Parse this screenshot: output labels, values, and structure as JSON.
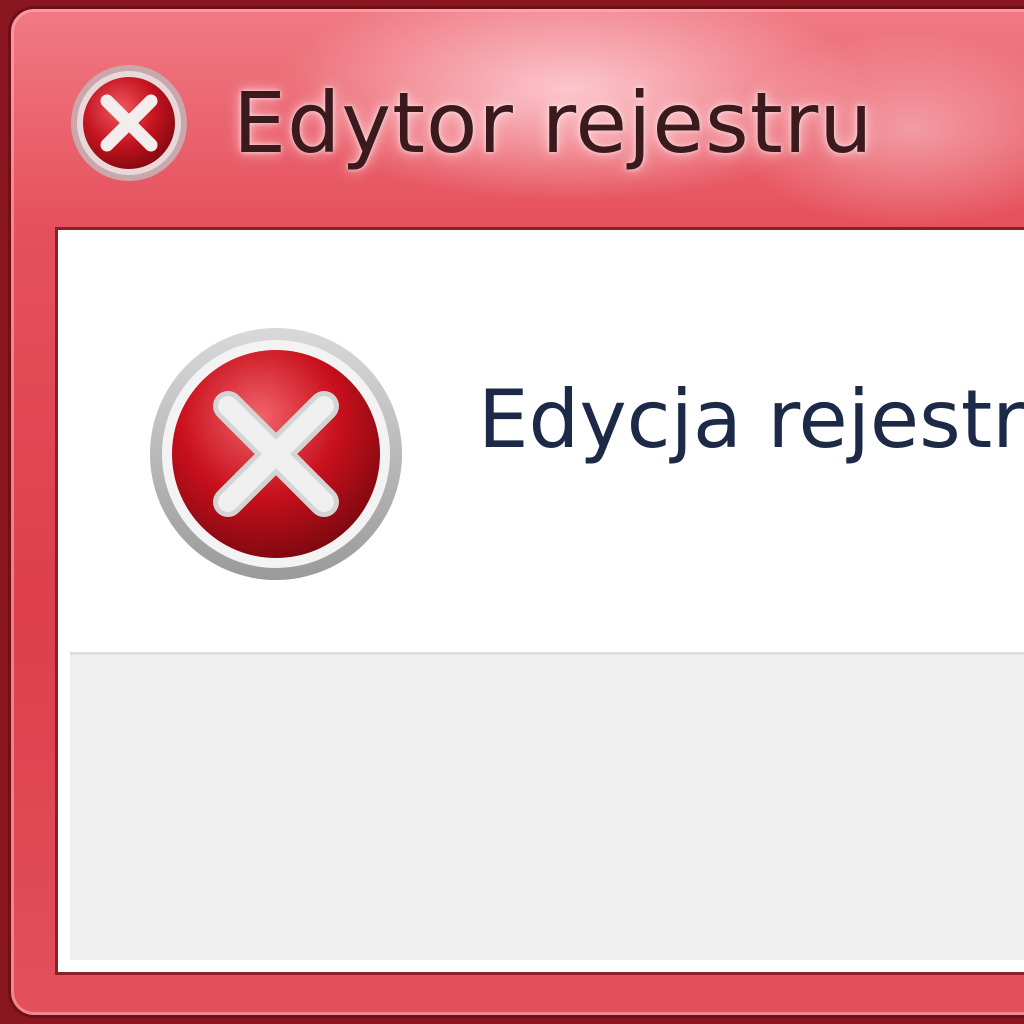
{
  "window": {
    "title": "Edytor rejestru",
    "title_icon": "error-icon"
  },
  "dialog": {
    "message": "Edycja rejestru",
    "message_icon": "error-icon"
  },
  "colors": {
    "frame_accent": "#dd3f4c",
    "error_red": "#c8101c",
    "message_text": "#1c2a48",
    "footer_bg": "#f0f0f0"
  }
}
